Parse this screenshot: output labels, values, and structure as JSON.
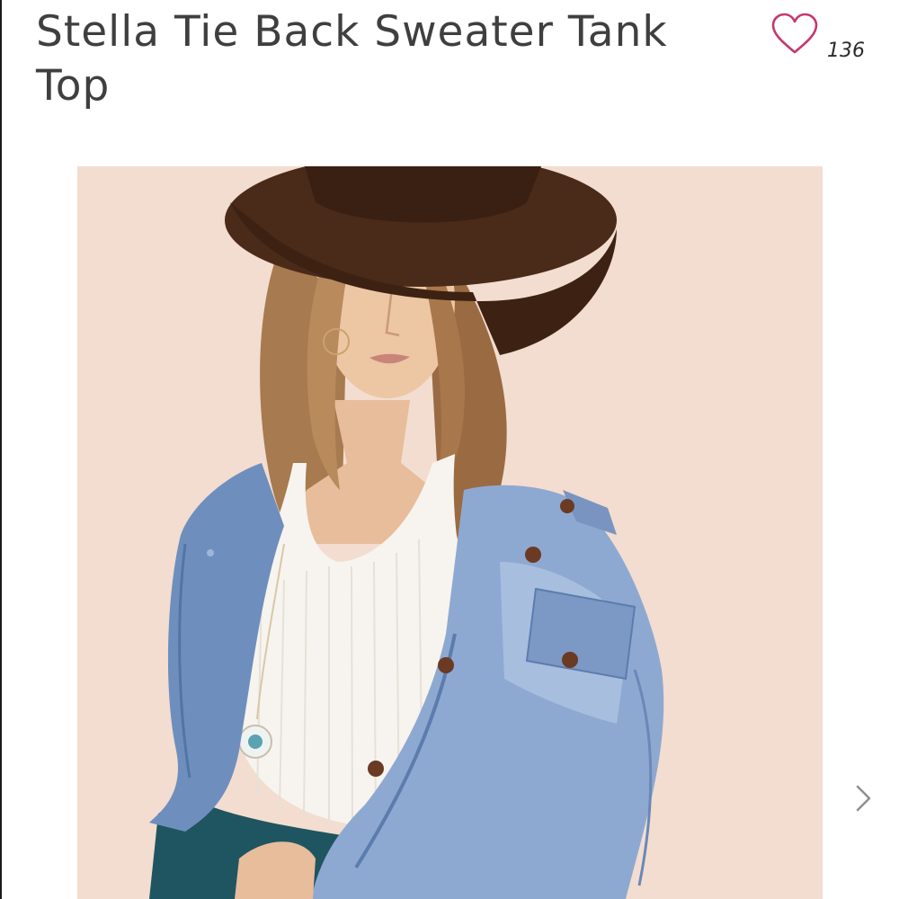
{
  "product": {
    "title": "Stella Tie Back Sweater Tank Top",
    "like_count": "136"
  },
  "icons": {
    "like": "heart-outline-icon",
    "next": "chevron-right-icon"
  },
  "colors": {
    "heart": "#c6376f",
    "title_text": "#3f3f3f",
    "photo_background": "#f2ddd0",
    "chevron": "#8f8f8f"
  }
}
